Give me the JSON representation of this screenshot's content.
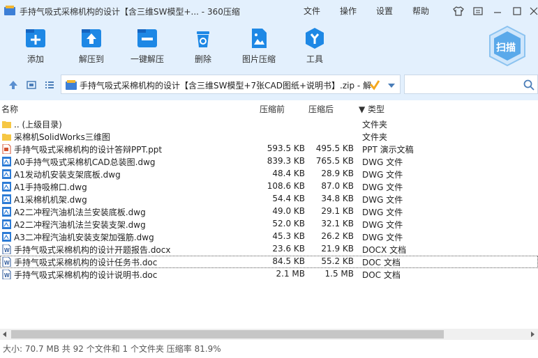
{
  "titlebar": {
    "title": "手持气吸式采棉机构的设计【含三维SW模型+... - 360压缩",
    "menus": [
      "文件",
      "操作",
      "设置",
      "帮助"
    ]
  },
  "toolbar": {
    "buttons": [
      {
        "label": "添加",
        "icon": "add-icon"
      },
      {
        "label": "解压到",
        "icon": "extract-icon"
      },
      {
        "label": "一键解压",
        "icon": "one-click-extract-icon"
      },
      {
        "label": "删除",
        "icon": "trash-icon"
      },
      {
        "label": "图片压缩",
        "icon": "image-compress-icon"
      },
      {
        "label": "工具",
        "icon": "tools-icon"
      }
    ],
    "scan_label": "扫描"
  },
  "address": {
    "path": "手持气吸式采棉机构的设计【含三维SW模型+7张CAD图纸+说明书】.zip - 解"
  },
  "columns": {
    "name": "名称",
    "csize": "压缩前",
    "psize": "压缩后",
    "type": "▼ 类型"
  },
  "files": [
    {
      "name": ".. (上级目录)",
      "csize": "",
      "psize": "",
      "type": "文件夹",
      "icon": "folder-icon"
    },
    {
      "name": "采棉机SolidWorks三维图",
      "csize": "",
      "psize": "",
      "type": "文件夹",
      "icon": "folder-icon"
    },
    {
      "name": "手持气吸式采棉机构的设计答辩PPT.ppt",
      "csize": "593.5 KB",
      "psize": "495.5 KB",
      "type": "PPT 演示文稿",
      "icon": "ppt-file-icon"
    },
    {
      "name": "A0手持气吸式采棉机CAD总装图.dwg",
      "csize": "839.3 KB",
      "psize": "765.5 KB",
      "type": "DWG 文件",
      "icon": "dwg-file-icon"
    },
    {
      "name": "A1发动机安装支架底板.dwg",
      "csize": "48.4 KB",
      "psize": "28.9 KB",
      "type": "DWG 文件",
      "icon": "dwg-file-icon"
    },
    {
      "name": "A1手持吸棉口.dwg",
      "csize": "108.6 KB",
      "psize": "87.0 KB",
      "type": "DWG 文件",
      "icon": "dwg-file-icon"
    },
    {
      "name": "A1采棉机机架.dwg",
      "csize": "54.4 KB",
      "psize": "34.8 KB",
      "type": "DWG 文件",
      "icon": "dwg-file-icon"
    },
    {
      "name": "A2二冲程汽油机法兰安装底板.dwg",
      "csize": "49.0 KB",
      "psize": "29.1 KB",
      "type": "DWG 文件",
      "icon": "dwg-file-icon"
    },
    {
      "name": "A2二冲程汽油机法兰安装支架.dwg",
      "csize": "52.0 KB",
      "psize": "32.1 KB",
      "type": "DWG 文件",
      "icon": "dwg-file-icon"
    },
    {
      "name": "A3二冲程汽油机安装支架加强筋.dwg",
      "csize": "45.3 KB",
      "psize": "26.2 KB",
      "type": "DWG 文件",
      "icon": "dwg-file-icon"
    },
    {
      "name": "手持气吸式采棉机构的设计开题报告.docx",
      "csize": "23.6 KB",
      "psize": "21.9 KB",
      "type": "DOCX 文档",
      "icon": "word-file-icon"
    },
    {
      "name": "手持气吸式采棉机构的设计任务书.doc",
      "csize": "84.5 KB",
      "psize": "55.2 KB",
      "type": "DOC 文档",
      "icon": "word-file-icon"
    },
    {
      "name": "手持气吸式采棉机构的设计说明书.doc",
      "csize": "2.1 MB",
      "psize": "1.5 MB",
      "type": "DOC 文档",
      "icon": "word-file-icon"
    }
  ],
  "status": "大小: 70.7 MB 共 92 个文件和 1 个文件夹 压缩率 81.9%",
  "colors": {
    "header_bg": "#e3f0fd",
    "accent": "#1e88e5",
    "folder": "#f6c744"
  }
}
